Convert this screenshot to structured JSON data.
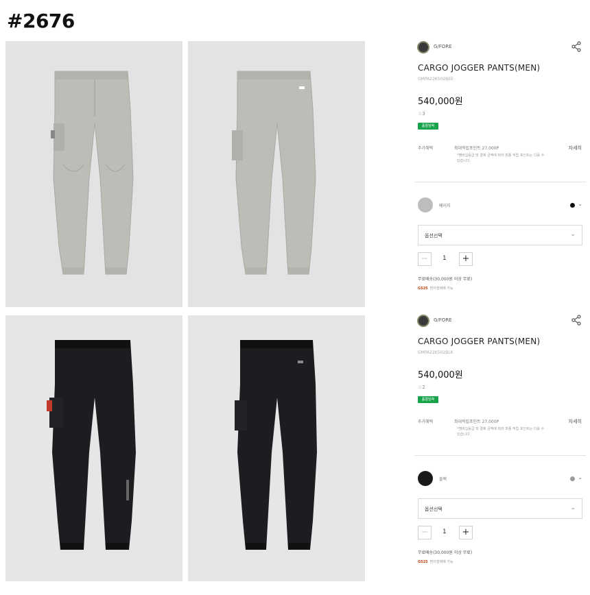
{
  "title": "#2676",
  "products": [
    {
      "brand": "G/FORE",
      "name": "CARGO JOGGER PANTS(MEN)",
      "code": "GMPA22K502BEE",
      "price": "540,000원",
      "review": "☆3",
      "badge": "품절임박",
      "point_label": "추가혜택",
      "point_main": "최대적립포인트 27,000P",
      "point_note": "*멤버십등급 및 결제 금액에 따라 최종 적립 포인트는 다를 수 있습니다.",
      "point_link": "자세히",
      "color_name": "베이지",
      "swatch_color": "#bdbdbd",
      "dot_color": "#111111",
      "select_placeholder": "옵션선택",
      "quantity": "1",
      "ship_main": "무료배송(30,000원 이상 무료)",
      "ship_sub": "편의점택배 가능",
      "ship_logo": "GS25"
    },
    {
      "brand": "G/FORE",
      "name": "CARGO JOGGER PANTS(MEN)",
      "code": "GMPA22K502BLK",
      "price": "540,000원",
      "review": "☆2",
      "badge": "품절임박",
      "point_label": "추가혜택",
      "point_main": "최대적립포인트 27,000P",
      "point_note": "*멤버십등급 및 결제 금액에 따라 최종 적립 포인트는 다를 수 있습니다.",
      "point_link": "자세히",
      "color_name": "블랙",
      "swatch_color": "#1a1a1a",
      "dot_color": "#9a9a9a",
      "select_placeholder": "옵션선택",
      "quantity": "1",
      "ship_main": "무료배송(30,000원 이상 무료)",
      "ship_sub": "편의점택배 가능",
      "ship_logo": "GS25"
    }
  ],
  "colors": {
    "beige_pant": "#bdbcb7",
    "black_pant": "#1c1d20",
    "photo_bg": "#e3e3e3",
    "accent_green": "#16a34a"
  }
}
